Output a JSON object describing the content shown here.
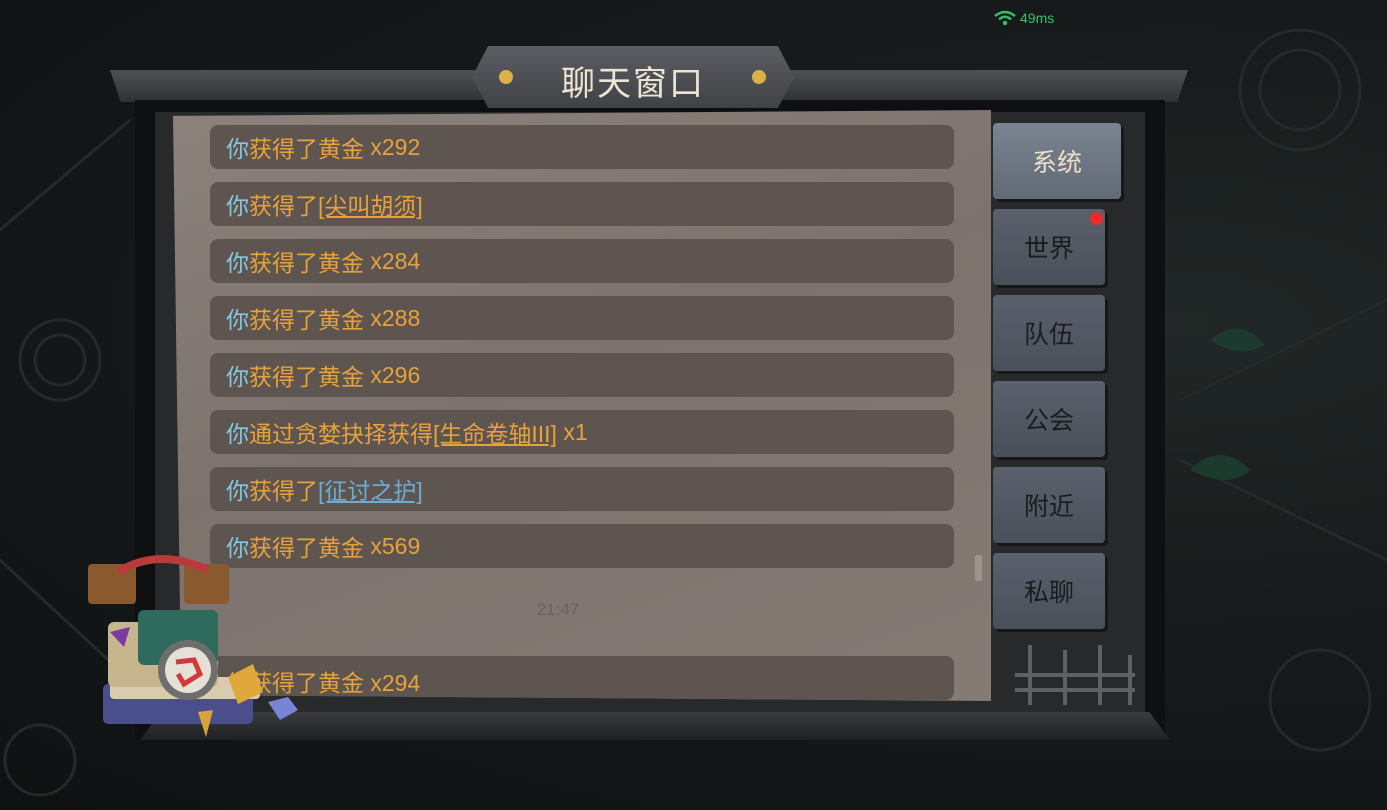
{
  "status": {
    "ping": "49ms",
    "icon": "wifi-icon",
    "color": "#34c16a"
  },
  "title": "聊天窗口",
  "messages": [
    {
      "you": "你",
      "text": "获得了黄金",
      "extra": " x292"
    },
    {
      "you": "你",
      "text": "获得了",
      "item": "[尖叫胡须]",
      "item_color": "gold"
    },
    {
      "you": "你",
      "text": "获得了黄金",
      "extra": " x284"
    },
    {
      "you": "你",
      "text": "获得了黄金",
      "extra": " x288"
    },
    {
      "you": "你",
      "text": "获得了黄金",
      "extra": " x296"
    },
    {
      "you": "你",
      "text": "通过贪婪抉择获得",
      "item": "[生命卷轴III]",
      "extra": " x1"
    },
    {
      "you": "你",
      "text": "获得了",
      "item": "[征讨之护]",
      "item_color": "blue"
    },
    {
      "you": "你",
      "text": "获得了黄金",
      "extra": " x569"
    }
  ],
  "timestamp": "21:47",
  "partial_message": "你获得了黄金 x294",
  "tabs": [
    {
      "label": "系统",
      "active": true
    },
    {
      "label": "世界",
      "badge": true
    },
    {
      "label": "队伍"
    },
    {
      "label": "公会"
    },
    {
      "label": "附近"
    },
    {
      "label": "私聊"
    }
  ],
  "colors": {
    "you": "#86c8e0",
    "gold": "#e8a23a",
    "blue_item": "#6aaed6",
    "badge": "#ee2a2a"
  }
}
